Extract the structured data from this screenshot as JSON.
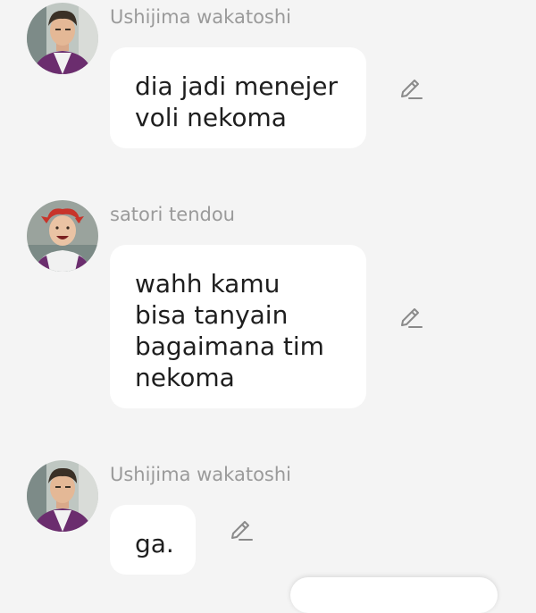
{
  "messages": [
    {
      "sender": "Ushijima wakatoshi",
      "lines": [
        "dia jadi menejer",
        "voli nekoma"
      ],
      "avatar_icon": "ushijima-avatar",
      "action_icon": "pencil-edit-icon"
    },
    {
      "sender": "satori tendou",
      "lines": [
        "wahh kamu",
        "bisa tanyain",
        "bagaimana tim",
        "nekoma"
      ],
      "avatar_icon": "tendou-avatar",
      "action_icon": "pencil-edit-icon"
    },
    {
      "sender": "Ushijima wakatoshi",
      "lines": [
        "ga."
      ],
      "avatar_icon": "ushijima-avatar",
      "action_icon": "pencil-edit-icon"
    }
  ],
  "colors": {
    "background": "#f4f4f4",
    "bubble": "#ffffff",
    "sender_text": "#9a9a9a",
    "message_text": "#1e1e1e",
    "icon": "#8a8a8a"
  }
}
